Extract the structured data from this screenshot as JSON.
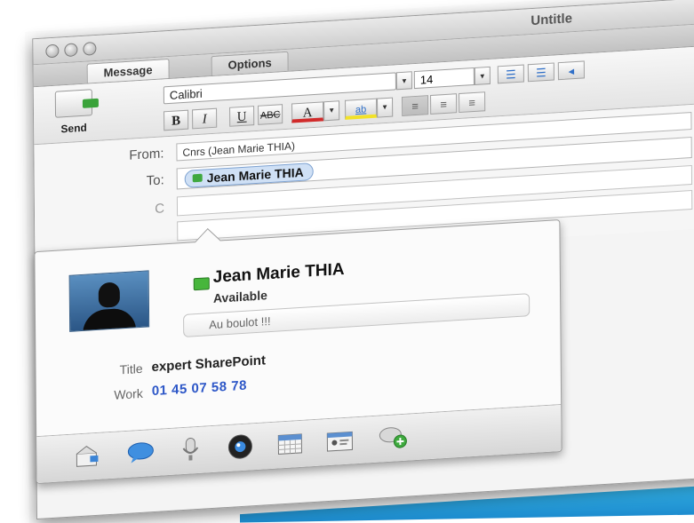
{
  "window": {
    "title": "Untitle"
  },
  "tabs": [
    {
      "label": "Message"
    },
    {
      "label": "Options"
    }
  ],
  "ribbon": {
    "send_label": "Send",
    "font_name": "Calibri",
    "font_size": "14",
    "bold": "B",
    "italic": "I",
    "underline": "U",
    "strike": "ABC",
    "font_color": "A"
  },
  "fields": {
    "from_label": "From:",
    "from_value": "Cnrs (Jean Marie  THIA)",
    "to_label": "To:",
    "to_recipient": "Jean Marie  THIA",
    "cc_label": "C"
  },
  "contact_card": {
    "name": "Jean Marie THIA",
    "availability": "Available",
    "note": "Au boulot !!!",
    "title_label": "Title",
    "title_value": "expert SharePoint",
    "work_label": "Work",
    "work_value": "01 45 07 58 78",
    "actions": [
      {
        "icon": "email-icon"
      },
      {
        "icon": "chat-icon"
      },
      {
        "icon": "microphone-icon"
      },
      {
        "icon": "webcam-icon"
      },
      {
        "icon": "calendar-icon"
      },
      {
        "icon": "contact-card-icon"
      },
      {
        "icon": "add-chat-icon"
      }
    ]
  },
  "colors": {
    "presence": "#47b63c",
    "link": "#2c56c7",
    "recipient_chip": "#cfe0f5"
  }
}
